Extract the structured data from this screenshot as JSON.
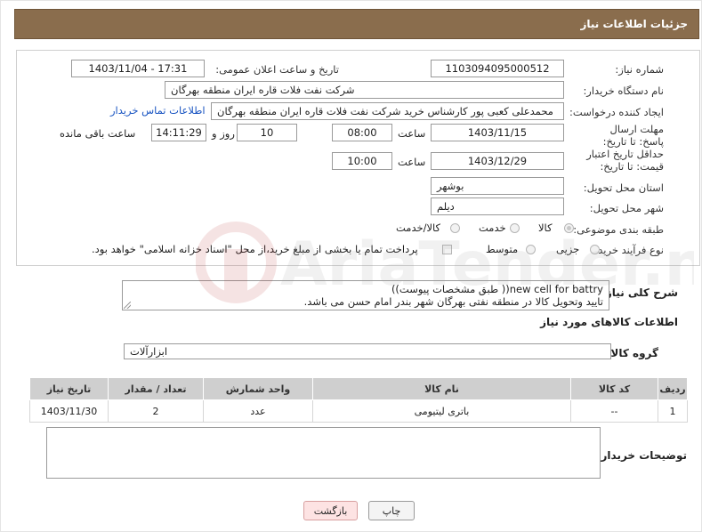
{
  "header": {
    "title": "جزئیات اطلاعات نیاز"
  },
  "form": {
    "need_number_label": "شماره نیاز:",
    "need_number": "1103094095000512",
    "announce_label": "تاریخ و ساعت اعلان عمومی:",
    "announce_value": "1403/11/04 - 17:31",
    "buyer_label": "نام دستگاه خریدار:",
    "buyer_value": "شرکت نفت فلات قاره ایران منطقه بهرگان",
    "creator_label": "ایجاد کننده درخواست:",
    "creator_value": "محمدعلی کعبی پور کارشناس خرید شرکت نفت فلات قاره ایران منطقه بهرگان",
    "contact_link": "اطلاعات تماس خریدار",
    "deadline_label": "مهلت ارسال پاسخ: تا تاریخ:",
    "deadline_date": "1403/11/15",
    "hour_label": "ساعت",
    "deadline_time": "08:00",
    "days_value": "10",
    "days_label": "روز و",
    "remaining_value": "14:11:29",
    "remaining_label": "ساعت باقی مانده",
    "validity_label": "حداقل تاریخ اعتبار قیمت: تا تاریخ:",
    "validity_date": "1403/12/29",
    "validity_hour_label": "ساعت",
    "validity_time": "10:00",
    "province_label": "استان محل تحویل:",
    "province_value": "بوشهر",
    "city_label": "شهر محل تحویل:",
    "city_value": "دیلم",
    "category_label": "طبقه بندی موضوعی:",
    "category_options": [
      "کالا",
      "خدمت",
      "کالا/خدمت"
    ],
    "category_selected": "کالا",
    "process_label": "نوع فرآیند خرید :",
    "process_options": [
      "جزیی",
      "متوسط"
    ],
    "payment_note": "پرداخت تمام یا بخشی از مبلغ خرید،از محل \"اسناد خزانه اسلامی\" خواهد بود."
  },
  "description": {
    "label": "شرح کلی نیاز:",
    "line1": "new cell for battry(( طبق مشخصات پیوست))",
    "line2": "تایید وتحویل کالا در منطقه نفتی بهرگان شهر بندر امام حسن می باشد."
  },
  "goods_section": {
    "title": "اطلاعات کالاهای مورد نیاز",
    "group_label": "گروه کالا:",
    "group_value": "ابزارآلات"
  },
  "table": {
    "headers": [
      "ردیف",
      "کد کالا",
      "نام کالا",
      "واحد شمارش",
      "تعداد / مقدار",
      "تاریخ نیاز"
    ],
    "rows": [
      [
        "1",
        "--",
        "باتری لیتیومی",
        "عدد",
        "2",
        "1403/11/30"
      ]
    ]
  },
  "buyer_notes": {
    "label": "توضیحات خریدار:",
    "value": ""
  },
  "buttons": {
    "print": "چاپ",
    "back": "بازگشت"
  },
  "watermark": {
    "text": "AriaTender.neT"
  },
  "colors": {
    "header_bg": "#8a6d4d",
    "table_header_bg": "#cfcfcf",
    "link": "#1a55c2",
    "back_button_bg": "#fde3e3"
  }
}
